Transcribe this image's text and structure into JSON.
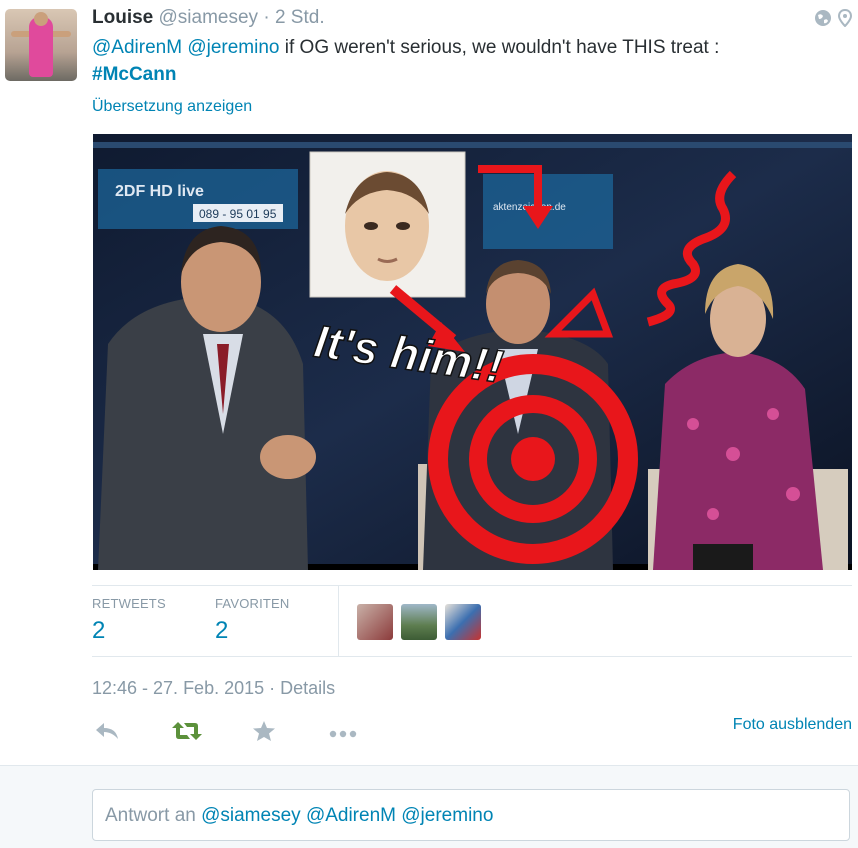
{
  "tweet": {
    "name": "Louise",
    "handle": "@siamesey",
    "separator": "·",
    "time_ago": "2 Std.",
    "mention1": "@AdirenM",
    "mention2": "@jeremino",
    "text": "if OG weren't serious, we wouldn't have THIS treat :",
    "hashtag": "#McCann",
    "translate_label": "Übersetzung anzeigen"
  },
  "photo": {
    "channel_logo": "2DF HD live",
    "phone_number": "089 - 95 01 95",
    "web_caption": "aktenzeichen.de",
    "overlay_text": "It's him!!",
    "colors": {
      "annotation": "#e8161b",
      "studio": "#1c2c4a"
    }
  },
  "stats": {
    "retweets_label": "RETWEETS",
    "retweets_count": "2",
    "favorites_label": "FAVORITEN",
    "favorites_count": "2"
  },
  "footer": {
    "timestamp": "12:46 - 27. Feb. 2015",
    "separator": "·",
    "details": "Details",
    "hide_photo": "Foto ausblenden"
  },
  "reply": {
    "prefix": "Antwort an",
    "mention1": "@siamesey",
    "mention2": "@AdirenM",
    "mention3": "@jeremino"
  },
  "icons": {
    "reply": "reply-icon",
    "retweet": "retweet-icon",
    "favorite": "star-icon",
    "more": "more-icon",
    "globe": "globe-icon",
    "location": "location-pin-icon"
  },
  "colors": {
    "link": "#0084b4",
    "muted": "#8899a6",
    "retweet_green": "#5c913b"
  }
}
